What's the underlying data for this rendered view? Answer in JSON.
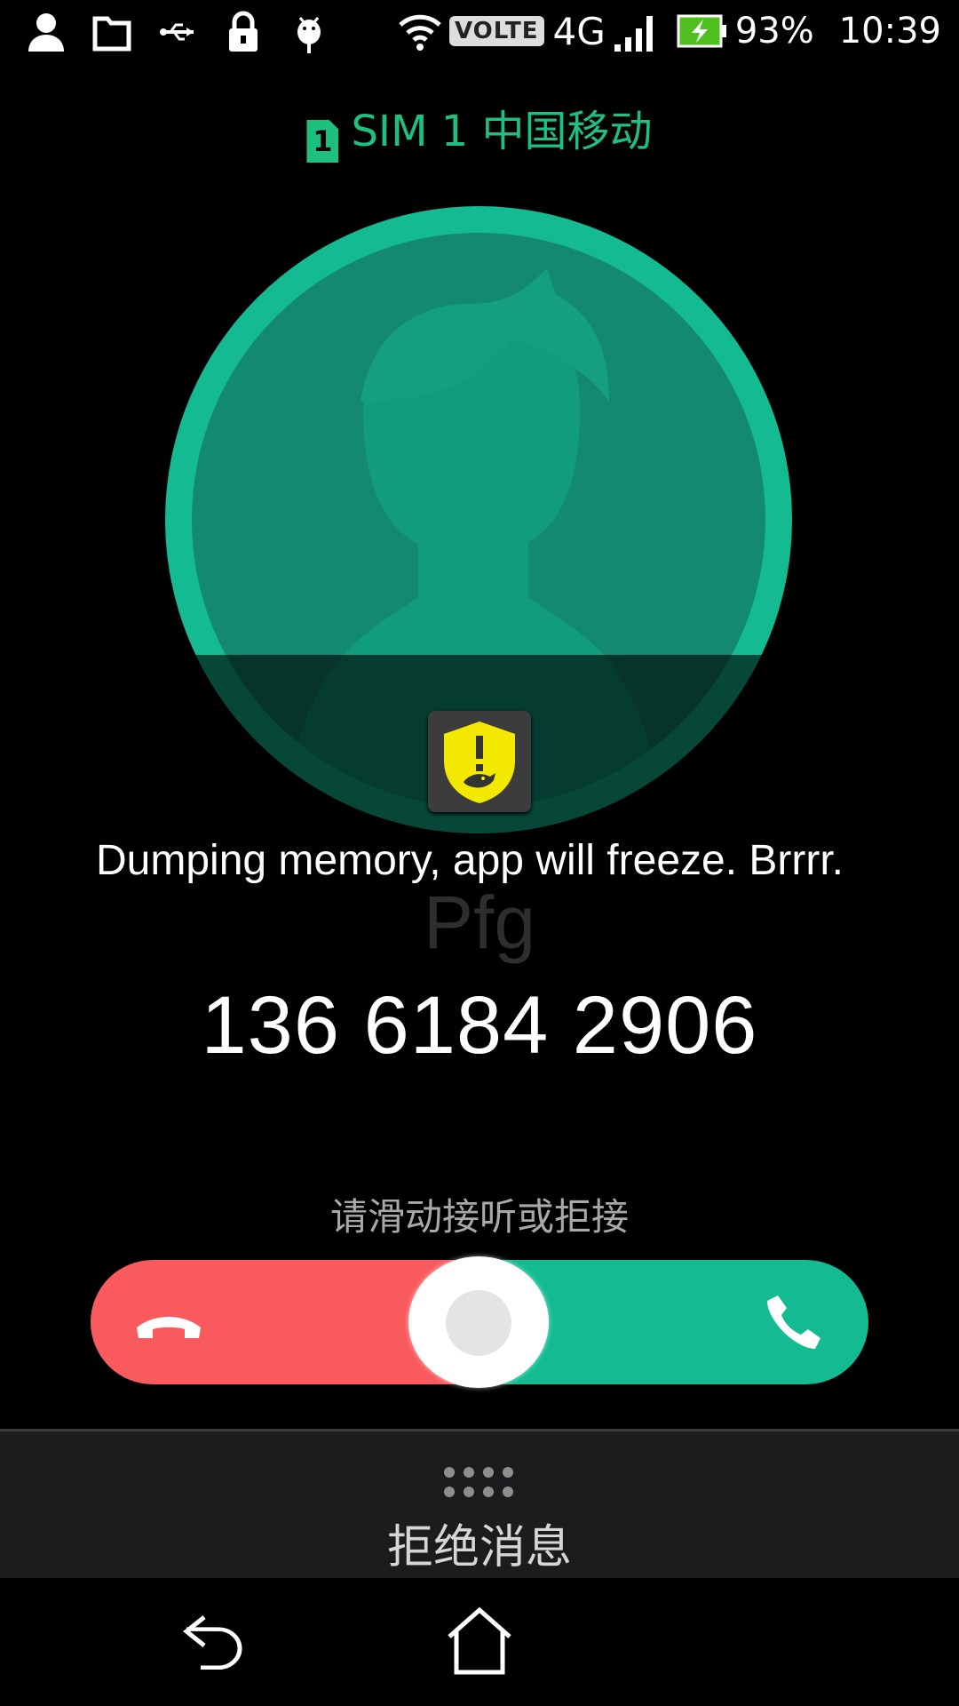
{
  "status_bar": {
    "left_icons": [
      "person-icon",
      "folder-icon",
      "usb-icon",
      "lock-icon",
      "android-debug-icon"
    ],
    "volte": "VOLTE",
    "network": "4G",
    "battery_percent": "93%",
    "time": "10:39"
  },
  "sim": {
    "badge": "1",
    "label": "SIM 1  中国移动"
  },
  "toast": {
    "text": "Dumping memory, app will freeze. Brrrr."
  },
  "caller": {
    "name": "Pfg",
    "number": "136 6184 2906"
  },
  "slider": {
    "hint": "请滑动接听或拒接",
    "decline_icon": "phone-hangup-icon",
    "accept_icon": "phone-answer-icon"
  },
  "reject_message": {
    "label": "拒绝消息"
  },
  "nav": {
    "back_icon": "back-icon",
    "home_icon": "home-icon"
  },
  "colors": {
    "accent_green": "#14bb92",
    "decline_red": "#f95a5d",
    "sim_green": "#1fbf80"
  }
}
